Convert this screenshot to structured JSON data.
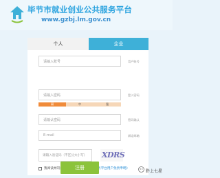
{
  "header": {
    "title": "毕节市就业创业公共服务平台",
    "url": "www.gzbj.lm.gov.cn",
    "logo_icon": "house-arrow-icon"
  },
  "tabs": [
    {
      "label": "个人",
      "active": false
    },
    {
      "label": "企业",
      "active": true
    }
  ],
  "form": {
    "account": {
      "placeholder": "请输入账号",
      "side_label": "用户账号"
    },
    "password": {
      "placeholder": "请输入密码",
      "side_label": "登入密码"
    },
    "strength": {
      "weak": "弱",
      "medium": "中",
      "strong": "强",
      "level": 1
    },
    "confirm": {
      "placeholder": "请输认密码",
      "side_label": "密码确认"
    },
    "email": {
      "placeholder": "E-mail",
      "side_label": "绑定邮箱"
    },
    "captcha": {
      "placeholder": "请输入验证码（不区分大小写）",
      "image_text": "XDRS"
    },
    "agree": {
      "prefix": "我阅读并同意",
      "link": "《毕节市就业创业公共服务平台用户免责申明》",
      "checked": false
    },
    "submit_label": "注册"
  },
  "watermark": {
    "text": "黔上七星"
  },
  "colors": {
    "accent": "#3eb0d8",
    "title": "#2aa3df",
    "submit": "#8bc33b",
    "weak": "#f08b3a"
  }
}
